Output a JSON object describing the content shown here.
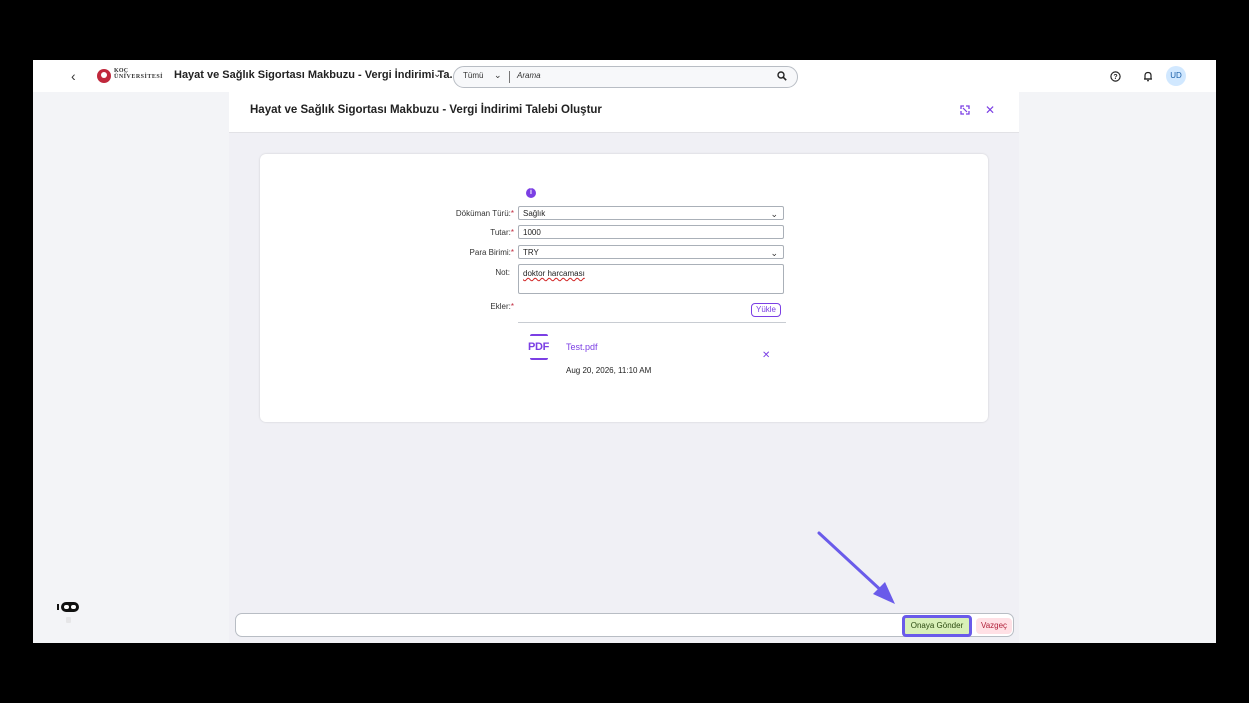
{
  "shell": {
    "logo_line1": "KOÇ",
    "logo_line2": "ÜNİVERSİTESİ",
    "app_title": "Hayat ve Sağlık Sigortası Makbuzu - Vergi İndirimi Ta...",
    "search": {
      "scope": "Tümü",
      "placeholder": "Arama"
    },
    "avatar_initials": "UD"
  },
  "dialog": {
    "title": "Hayat ve Sağlık Sigortası Makbuzu - Vergi İndirimi Talebi Oluştur",
    "form": {
      "document_type": {
        "label": "Döküman Türü:",
        "value": "Sağlık"
      },
      "amount": {
        "label": "Tutar:",
        "value": "1000"
      },
      "currency": {
        "label": "Para Birimi:",
        "value": "TRY"
      },
      "note": {
        "label": "Not:",
        "value": "doktor harcaması"
      },
      "attachments": {
        "label": "Ekler:",
        "upload_label": "Yükle"
      }
    },
    "attachment": {
      "icon_text": "PDF",
      "file_name": "Test.pdf",
      "date": "Aug 20, 2026, 11:10 AM"
    },
    "footer": {
      "submit_label": "Onaya Gönder",
      "cancel_label": "Vazgeç"
    }
  },
  "colors": {
    "accent": "#7b3fe4",
    "required": "#c0283c",
    "submit_bg": "#d9f0b8",
    "cancel_bg": "#ffe0e5",
    "highlight": "#6a5bea"
  }
}
